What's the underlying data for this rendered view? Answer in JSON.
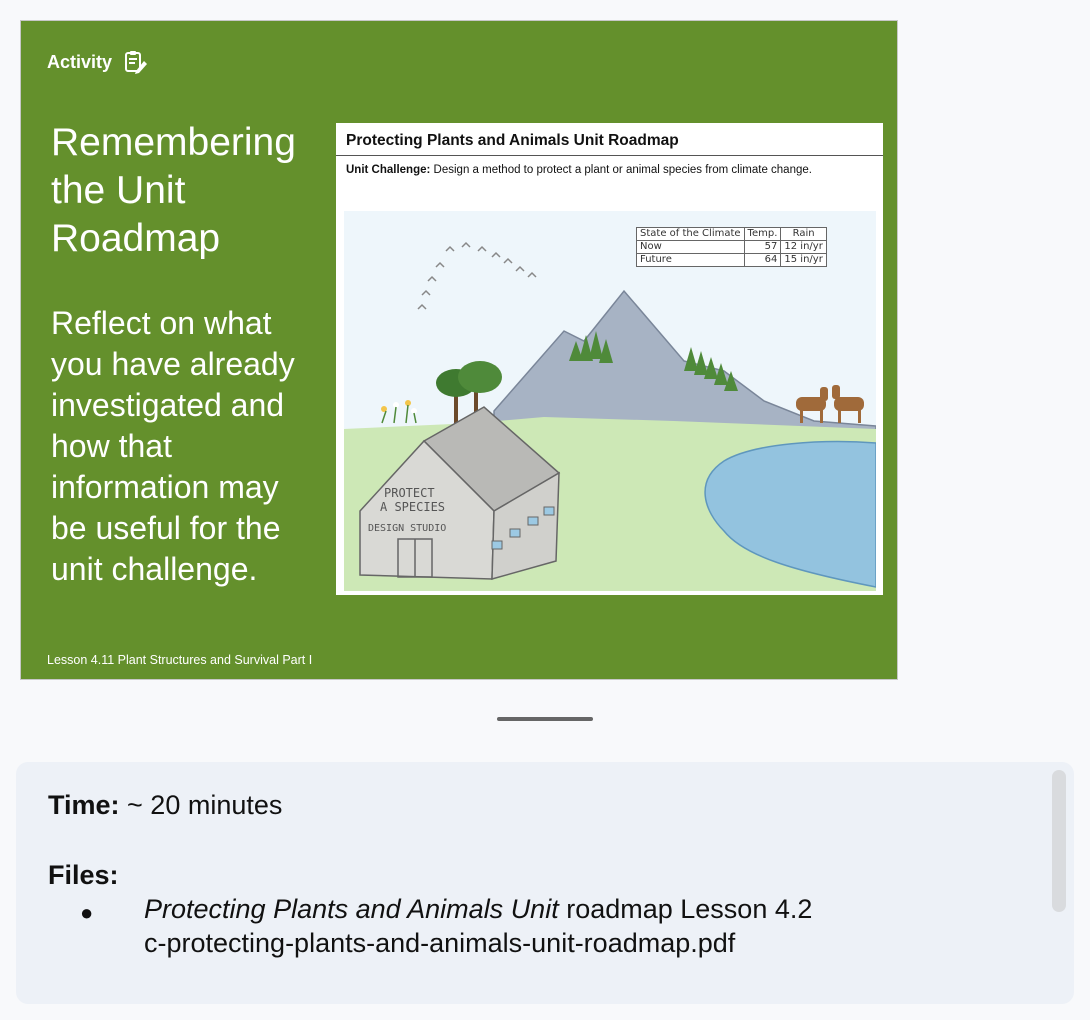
{
  "slide": {
    "activity_label": "Activity",
    "title": "Remembering the Unit Roadmap",
    "body": "Reflect on what you have already investigated and how that information may be useful for the unit challenge.",
    "footer": "Lesson 4.11 Plant Structures and Survival Part I",
    "bg_color": "#64902c"
  },
  "roadmap": {
    "title": "Protecting Plants and Animals Unit Roadmap",
    "challenge_label": "Unit Challenge:",
    "challenge_text": " Design a method to protect a plant or animal species from climate change.",
    "table": {
      "headers": [
        "State of the Climate",
        "Temp.",
        "Rain"
      ],
      "rows": [
        [
          "Now",
          "57",
          "12 in/yr"
        ],
        [
          "Future",
          "64",
          "15 in/yr"
        ]
      ]
    },
    "building_sign": [
      "PROTECT",
      "A SPECIES",
      "DESIGN STUDIO"
    ]
  },
  "panel": {
    "time_label": "Time:",
    "time_value": " ~ 20 minutes",
    "files_label": "Files:",
    "bullet": "●",
    "file_italic": "Protecting Plants and Animals Unit",
    "file_rest": " roadmap Lesson 4.2",
    "file_name": "c-protecting-plants-and-animals-unit-roadmap.pdf"
  }
}
